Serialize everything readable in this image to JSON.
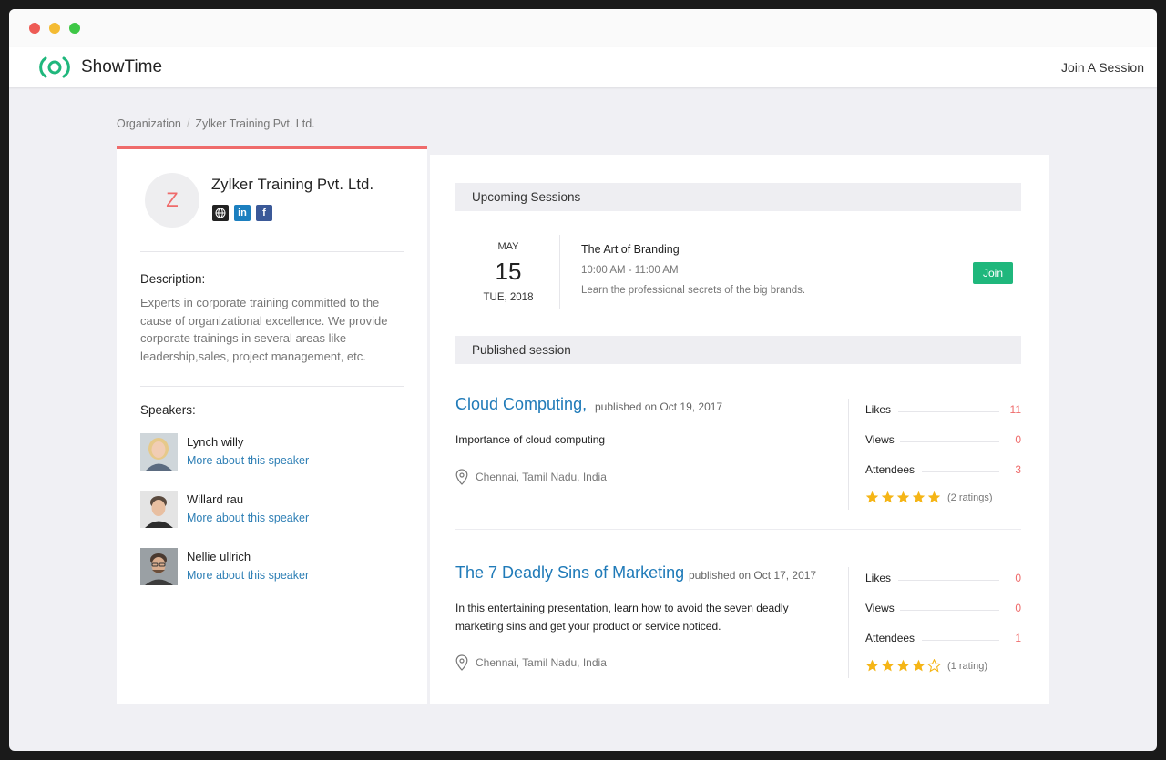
{
  "app": {
    "name": "ShowTime",
    "join_link": "Join A Session",
    "accent": "#1fb77c",
    "brand_red": "#ef6b6b"
  },
  "breadcrumb": {
    "items": [
      "Organization",
      "Zylker Training Pvt. Ltd."
    ],
    "separator": "/"
  },
  "org": {
    "initial": "Z",
    "name": "Zylker Training Pvt. Ltd.",
    "socials": [
      {
        "icon": "globe-icon",
        "glyph": "⊕"
      },
      {
        "icon": "linkedin-icon",
        "glyph": "in"
      },
      {
        "icon": "facebook-icon",
        "glyph": "f"
      }
    ],
    "description_title": "Description:",
    "description": "Experts in corporate training committed to the cause of organizational excellence. We provide corporate trainings in several areas like leadership,sales, project management, etc.",
    "speakers_title": "Speakers:",
    "speakers": [
      {
        "name": "Lynch willy",
        "link": "More about this speaker"
      },
      {
        "name": "Willard rau",
        "link": "More about this speaker"
      },
      {
        "name": "Nellie ullrich",
        "link": "More about this speaker"
      }
    ]
  },
  "upcoming": {
    "header": "Upcoming Sessions",
    "session": {
      "month": "MAY",
      "day": "15",
      "weekday_year": "TUE, 2018",
      "title": "The Art of Branding",
      "time": "10:00 AM - 11:00 AM",
      "description": "Learn the professional secrets of the big brands.",
      "button": "Join"
    }
  },
  "published": {
    "header": "Published session",
    "sessions": [
      {
        "title": "Cloud Computing,",
        "published": "published on Oct 19, 2017",
        "description": "Importance of cloud computing",
        "location": "Chennai, Tamil Nadu, India",
        "stats": {
          "likes_label": "Likes",
          "likes": "11",
          "views_label": "Views",
          "views": "0",
          "attendees_label": "Attendees",
          "attendees": "3"
        },
        "rating": 5,
        "rating_text": "(2 ratings)"
      },
      {
        "title": "The 7 Deadly Sins of Marketing",
        "published": "published on Oct 17, 2017",
        "description": "In this entertaining presentation, learn how to avoid the seven deadly marketing sins and get your product or service noticed.",
        "location": "Chennai, Tamil Nadu, India",
        "stats": {
          "likes_label": "Likes",
          "likes": "0",
          "views_label": "Views",
          "views": "0",
          "attendees_label": "Attendees",
          "attendees": "1"
        },
        "rating": 4,
        "rating_text": "(1 rating)"
      }
    ]
  }
}
